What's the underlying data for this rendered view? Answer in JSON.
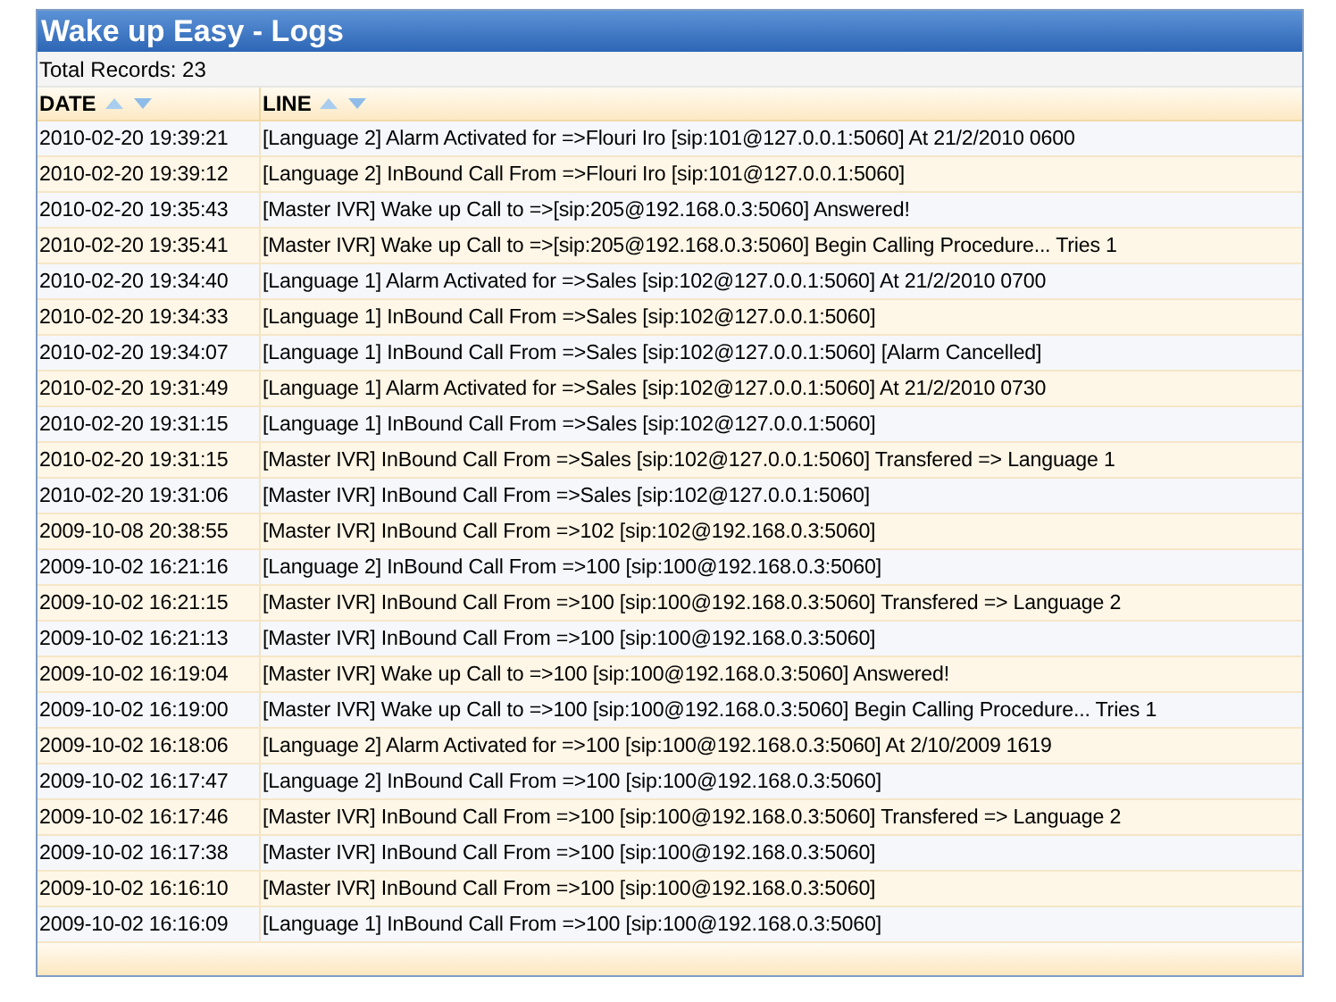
{
  "window": {
    "title": "Wake up Easy - Logs"
  },
  "total_records": "Total Records: 23",
  "table": {
    "columns": [
      "DATE",
      "LINE"
    ],
    "rows": [
      [
        "2010-02-20 19:39:21",
        "[Language 2] Alarm Activated for =>Flouri Iro [sip:101@127.0.0.1:5060] At 21/2/2010 0600"
      ],
      [
        "2010-02-20 19:39:12",
        "[Language 2] InBound Call From =>Flouri Iro [sip:101@127.0.0.1:5060]"
      ],
      [
        "2010-02-20 19:35:43",
        "[Master IVR] Wake up Call to =>[sip:205@192.168.0.3:5060] Answered!"
      ],
      [
        "2010-02-20 19:35:41",
        "[Master IVR] Wake up Call to =>[sip:205@192.168.0.3:5060] Begin Calling Procedure... Tries 1"
      ],
      [
        "2010-02-20 19:34:40",
        "[Language 1] Alarm Activated for =>Sales [sip:102@127.0.0.1:5060] At 21/2/2010 0700"
      ],
      [
        "2010-02-20 19:34:33",
        "[Language 1] InBound Call From =>Sales [sip:102@127.0.0.1:5060]"
      ],
      [
        "2010-02-20 19:34:07",
        "[Language 1] InBound Call From =>Sales [sip:102@127.0.0.1:5060] [Alarm Cancelled]"
      ],
      [
        "2010-02-20 19:31:49",
        "[Language 1] Alarm Activated for =>Sales [sip:102@127.0.0.1:5060] At 21/2/2010 0730"
      ],
      [
        "2010-02-20 19:31:15",
        "[Language 1] InBound Call From =>Sales [sip:102@127.0.0.1:5060]"
      ],
      [
        "2010-02-20 19:31:15",
        "[Master IVR] InBound Call From =>Sales [sip:102@127.0.0.1:5060] Transfered => Language 1"
      ],
      [
        "2010-02-20 19:31:06",
        "[Master IVR] InBound Call From =>Sales [sip:102@127.0.0.1:5060]"
      ],
      [
        "2009-10-08 20:38:55",
        "[Master IVR] InBound Call From =>102 [sip:102@192.168.0.3:5060]"
      ],
      [
        "2009-10-02 16:21:16",
        "[Language 2] InBound Call From =>100 [sip:100@192.168.0.3:5060]"
      ],
      [
        "2009-10-02 16:21:15",
        "[Master IVR] InBound Call From =>100 [sip:100@192.168.0.3:5060] Transfered => Language 2"
      ],
      [
        "2009-10-02 16:21:13",
        "[Master IVR] InBound Call From =>100 [sip:100@192.168.0.3:5060]"
      ],
      [
        "2009-10-02 16:19:04",
        "[Master IVR] Wake up Call to =>100 [sip:100@192.168.0.3:5060] Answered!"
      ],
      [
        "2009-10-02 16:19:00",
        "[Master IVR] Wake up Call to =>100 [sip:100@192.168.0.3:5060] Begin Calling Procedure... Tries 1"
      ],
      [
        "2009-10-02 16:18:06",
        "[Language 2] Alarm Activated for =>100 [sip:100@192.168.0.3:5060] At 2/10/2009 1619"
      ],
      [
        "2009-10-02 16:17:47",
        "[Language 2] InBound Call From =>100 [sip:100@192.168.0.3:5060]"
      ],
      [
        "2009-10-02 16:17:46",
        "[Master IVR] InBound Call From =>100 [sip:100@192.168.0.3:5060] Transfered => Language 2"
      ],
      [
        "2009-10-02 16:17:38",
        "[Master IVR] InBound Call From =>100 [sip:100@192.168.0.3:5060]"
      ],
      [
        "2009-10-02 16:16:10",
        "[Master IVR] InBound Call From =>100 [sip:100@192.168.0.3:5060]"
      ],
      [
        "2009-10-02 16:16:09",
        "[Language 1] InBound Call From =>100 [sip:100@192.168.0.3:5060]"
      ]
    ]
  }
}
